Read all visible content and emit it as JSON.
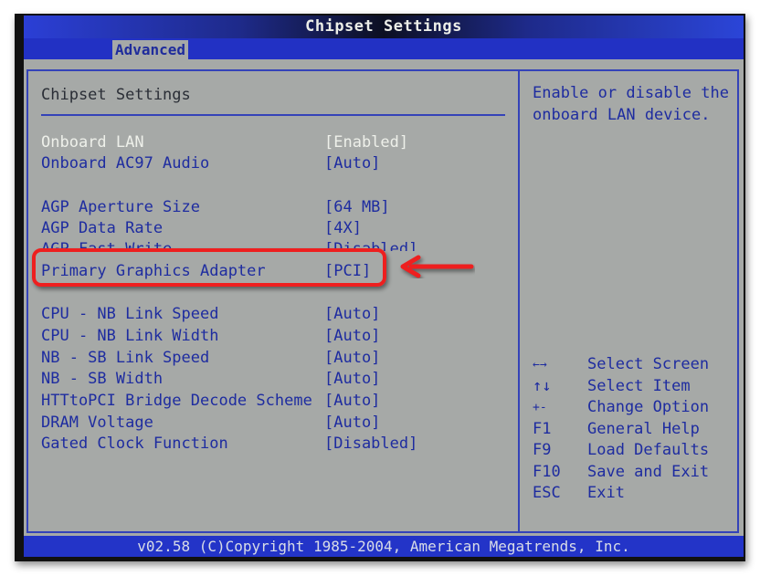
{
  "window": {
    "title": "Chipset Settings"
  },
  "tabs": [
    {
      "label": "Advanced",
      "active": true
    }
  ],
  "main": {
    "section_title": "Chipset Settings",
    "settings": [
      {
        "label": "Onboard LAN",
        "value": "[Enabled]",
        "selected": true
      },
      {
        "label": "Onboard AC97 Audio",
        "value": "[Auto]"
      },
      {
        "label": "AGP Aperture Size",
        "value": "[64 MB]"
      },
      {
        "label": "AGP Data Rate",
        "value": "[4X]"
      },
      {
        "label": "AGP Fast Write",
        "value": "[Disabled]"
      },
      {
        "label": "Primary Graphics Adapter",
        "value": "[PCI]",
        "highlighted": true
      },
      {
        "label": "CPU - NB Link Speed",
        "value": "[Auto]"
      },
      {
        "label": "CPU - NB Link Width",
        "value": "[Auto]"
      },
      {
        "label": "NB - SB Link Speed",
        "value": "[Auto]"
      },
      {
        "label": "NB - SB Width",
        "value": "[Auto]"
      },
      {
        "label": "HTTtoPCI Bridge Decode Scheme",
        "value": "[Auto]"
      },
      {
        "label": "DRAM Voltage",
        "value": "[Auto]"
      },
      {
        "label": "Gated Clock Function",
        "value": "[Disabled]"
      }
    ]
  },
  "help": {
    "line1": "Enable or disable the",
    "line2": "onboard LAN device."
  },
  "keys": [
    {
      "key": "←→",
      "action": "Select Screen",
      "icon": "left-right-arrows-icon"
    },
    {
      "key": "↑↓",
      "action": "Select Item",
      "icon": "up-down-arrows-icon"
    },
    {
      "key": "+-",
      "action": "Change Option"
    },
    {
      "key": "F1",
      "action": "General Help"
    },
    {
      "key": "F9",
      "action": "Load Defaults"
    },
    {
      "key": "F10",
      "action": "Save and Exit"
    },
    {
      "key": "ESC",
      "action": "Exit"
    }
  ],
  "footer": {
    "text": "v02.58 (C)Copyright 1985-2004, American Megatrends, Inc."
  },
  "annotation": {
    "color": "#ee1f1f",
    "target": "Primary Graphics Adapter"
  }
}
